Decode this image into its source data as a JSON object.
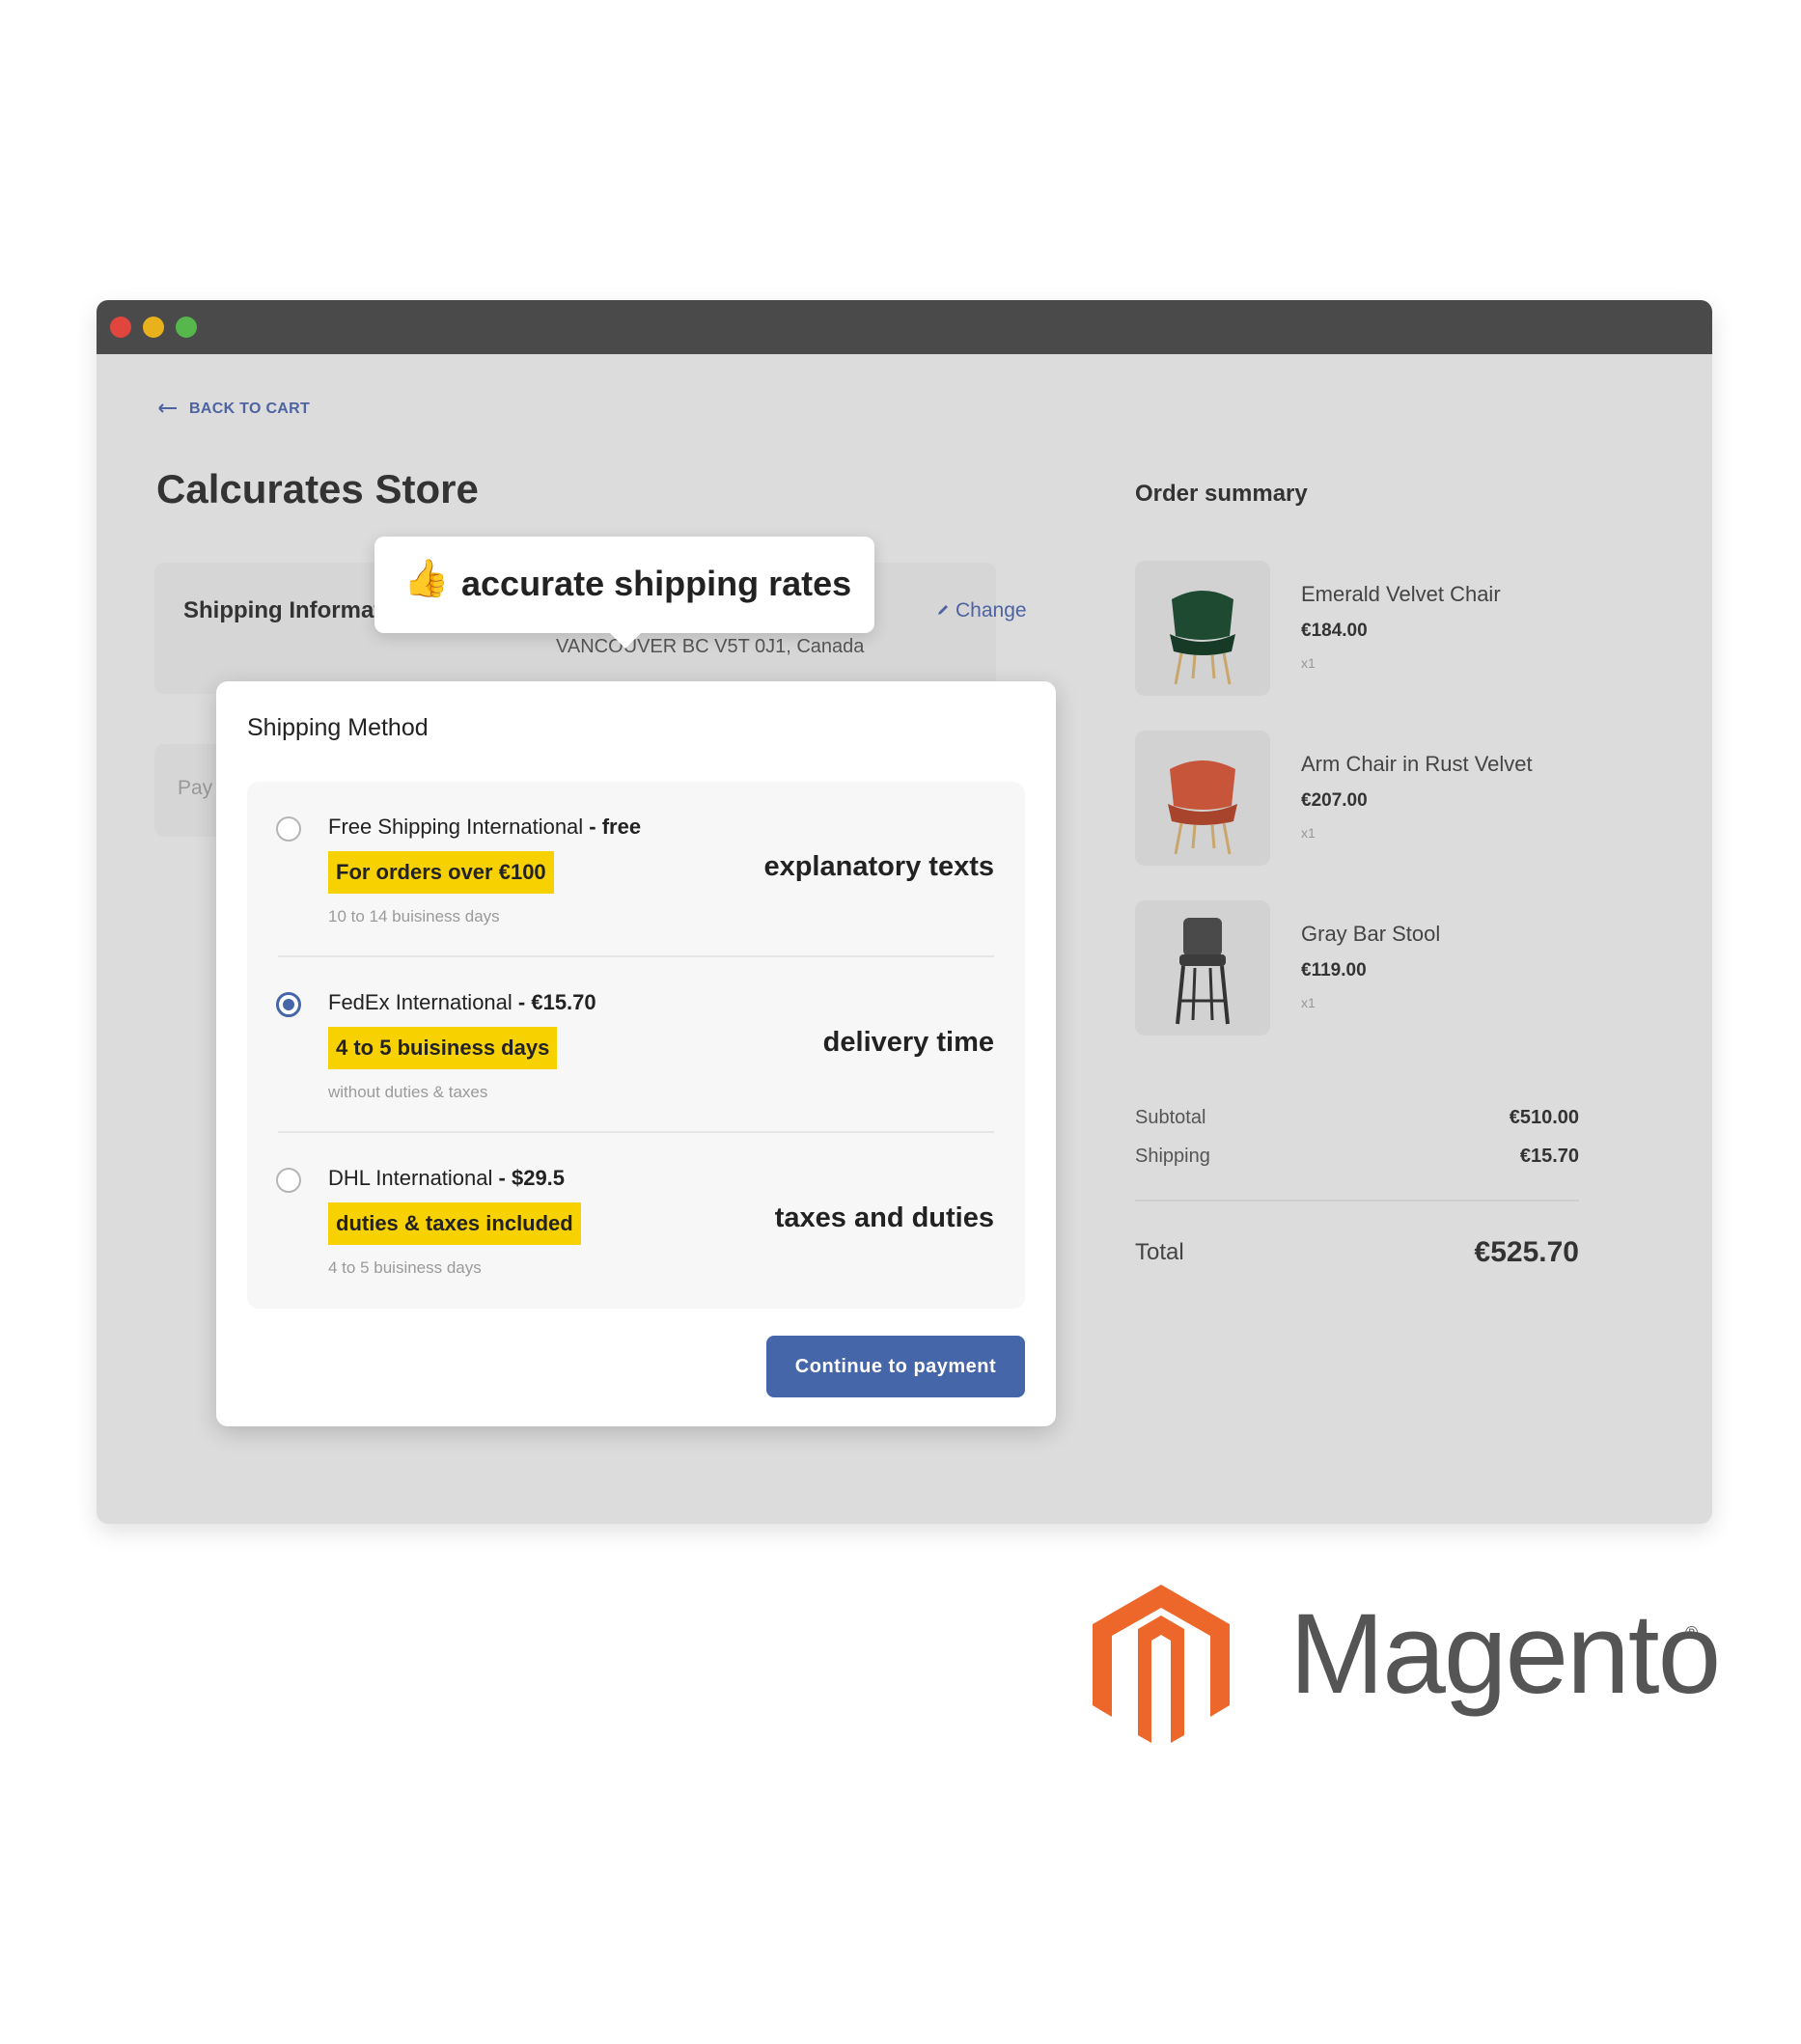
{
  "window": {
    "traffic_lights": [
      "close",
      "minimize",
      "maximize"
    ]
  },
  "header": {
    "back_label": "BACK TO CART",
    "store_title": "Calcurates Store"
  },
  "shipping_info": {
    "label": "Shipping Informat",
    "address_line_partial": "",
    "address_line2": "VANCOUVER BC V5T 0J1, Canada",
    "change_label": "Change"
  },
  "payment": {
    "label": "Pay"
  },
  "tooltip": {
    "icon": "👍",
    "text": "accurate shipping rates"
  },
  "shipping_method": {
    "title": "Shipping Method",
    "options": [
      {
        "name": "Free Shipping International",
        "price": "- free",
        "badge": "For orders over €100",
        "sub": "10 to 14 buisiness days",
        "note": "explanatory texts",
        "selected": false
      },
      {
        "name": "FedEx International",
        "price": "- €15.70",
        "badge": "4 to 5 buisiness days",
        "sub": "without duties & taxes",
        "note": "delivery time",
        "selected": true
      },
      {
        "name": "DHL International",
        "price": "- $29.5",
        "badge": "duties & taxes included",
        "sub": "4 to 5 buisiness days",
        "note": "taxes and duties",
        "selected": false
      }
    ],
    "continue_label": "Continue to payment"
  },
  "order_summary": {
    "title": "Order summary",
    "items": [
      {
        "name": "Emerald Velvet Chair",
        "price": "€184.00",
        "qty": "x1",
        "color": "#1f4a32"
      },
      {
        "name": "Arm Chair in Rust Velvet",
        "price": "€207.00",
        "qty": "x1",
        "color": "#c6553a"
      },
      {
        "name": "Gray Bar Stool",
        "price": "€119.00",
        "qty": "x1",
        "color": "#4a4a4a"
      }
    ],
    "subtotal_label": "Subtotal",
    "subtotal_value": "€510.00",
    "shipping_label": "Shipping",
    "shipping_value": "€15.70",
    "total_label": "Total",
    "total_value": "€525.70"
  },
  "brand": {
    "name": "Magento",
    "reg": "®",
    "accent": "#ee672a"
  },
  "colors": {
    "primary": "#4566a8",
    "highlight": "#f8d100"
  }
}
